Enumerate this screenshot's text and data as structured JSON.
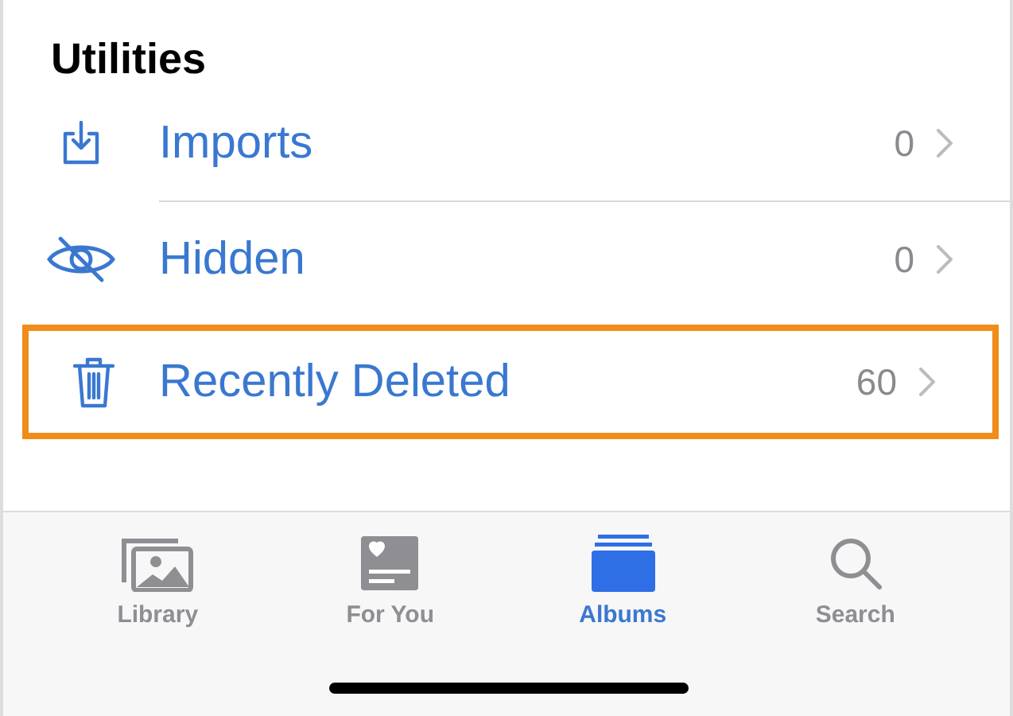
{
  "section": {
    "title": "Utilities"
  },
  "items": [
    {
      "kind": "imports",
      "label": "Imports",
      "count": "0",
      "highlighted": false
    },
    {
      "kind": "hidden",
      "label": "Hidden",
      "count": "0",
      "highlighted": false
    },
    {
      "kind": "deleted",
      "label": "Recently Deleted",
      "count": "60",
      "highlighted": true
    }
  ],
  "tabs": [
    {
      "kind": "library",
      "label": "Library",
      "selected": false
    },
    {
      "kind": "foryou",
      "label": "For You",
      "selected": false
    },
    {
      "kind": "albums",
      "label": "Albums",
      "selected": true
    },
    {
      "kind": "search",
      "label": "Search",
      "selected": false
    }
  ]
}
